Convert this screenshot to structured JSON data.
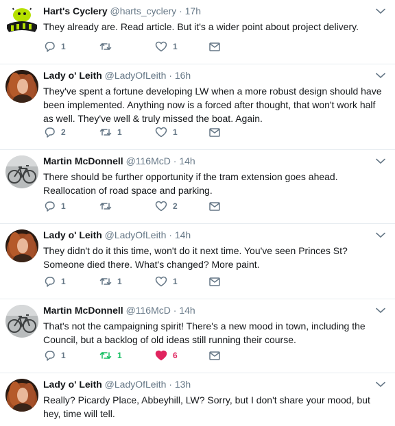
{
  "colors": {
    "text": "#14171a",
    "muted": "#657786",
    "divider": "#e6ecf0",
    "retweeted": "#17bf63",
    "liked": "#e0245e"
  },
  "icons": {
    "reply": "reply-icon",
    "retweet": "retweet-icon",
    "like": "heart-icon",
    "message": "envelope-icon",
    "caret": "chevron-down-icon"
  },
  "tweets": [
    {
      "name": "Hart's Cyclery",
      "handle": "@harts_cyclery",
      "time": "17h",
      "text": "They already are. Read article. But it's a wider point about project delivery.",
      "replies": "1",
      "retweets": "",
      "likes": "1",
      "retweeted": false,
      "liked": false,
      "avatar": "hart-logo"
    },
    {
      "name": "Lady o' Leith",
      "handle": "@LadyOfLeith",
      "time": "16h",
      "text": "They've spent a fortune developing LW when a more robust design should have been implemented. Anything now is a forced after thought, that won't work half as well. They've well & truly missed the boat. Again.",
      "replies": "2",
      "retweets": "1",
      "likes": "1",
      "retweeted": false,
      "liked": false,
      "avatar": "portrait"
    },
    {
      "name": "Martin McDonnell",
      "handle": "@116McD",
      "time": "14h",
      "text": "There should be further opportunity if the tram extension goes ahead. Reallocation of road space and parking.",
      "replies": "1",
      "retweets": "",
      "likes": "2",
      "retweeted": false,
      "liked": false,
      "avatar": "bicycle"
    },
    {
      "name": "Lady o' Leith",
      "handle": "@LadyOfLeith",
      "time": "14h",
      "text": "They didn't do it this time, won't do it next time. You've seen Princes St? Someone died there. What's changed? More paint.",
      "replies": "1",
      "retweets": "1",
      "likes": "1",
      "retweeted": false,
      "liked": false,
      "avatar": "portrait"
    },
    {
      "name": "Martin McDonnell",
      "handle": "@116McD",
      "time": "14h",
      "text": "That's not the campaigning spirit! There's a new mood in town, including the Council, but a backlog of old ideas still running their course.",
      "replies": "1",
      "retweets": "1",
      "likes": "6",
      "retweeted": true,
      "liked": true,
      "avatar": "bicycle"
    },
    {
      "name": "Lady o' Leith",
      "handle": "@LadyOfLeith",
      "time": "13h",
      "text": "Really? Picardy Place, Abbeyhill, LW? Sorry, but I don't share your mood, but hey, time will tell.",
      "replies": "",
      "retweets": "",
      "likes": "",
      "retweeted": false,
      "liked": false,
      "avatar": "portrait"
    }
  ]
}
